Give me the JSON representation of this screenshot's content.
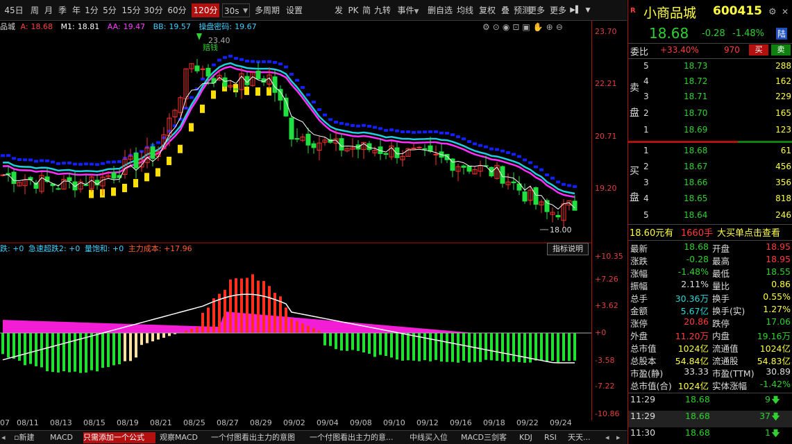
{
  "toolbar": {
    "periods": [
      "45日",
      "周",
      "月",
      "季",
      "年",
      "1分",
      "5分",
      "15分",
      "30分",
      "60分",
      "120分"
    ],
    "active_period": "120分",
    "period_dropdown": "30s",
    "items": [
      "多周期",
      "设置",
      "发",
      "PK",
      "简",
      "九转",
      "事件",
      "删自选",
      "均线",
      "复权",
      "叠",
      "预测",
      "更多"
    ],
    "more_arrow": "▶▌",
    "dropdown_icon": "▼"
  },
  "main_chart": {
    "stock_short": "品城",
    "indicators": [
      {
        "label": "A:",
        "value": "18.68",
        "color": "#ff4040"
      },
      {
        "label": "M1:",
        "value": "18.81",
        "color": "#ffffff"
      },
      {
        "label": "AA:",
        "value": "19.47",
        "color": "#ff40ff"
      },
      {
        "label": "BB:",
        "value": "19.57",
        "color": "#40d0ff"
      },
      {
        "label": "操盘密码:",
        "value": "19.67",
        "color": "#40d0ff"
      }
    ],
    "high_label": "23.40",
    "high_note": "赔钱",
    "low_label": "18.00",
    "price_ticks": [
      "23.70",
      "22.21",
      "20.71",
      "19.20"
    ]
  },
  "sub_chart": {
    "labels": [
      {
        "text": "跌: +0",
        "color": "#40d0ff"
      },
      {
        "text": "急速超跌2: +0",
        "color": "#40d0ff"
      },
      {
        "text": "量饱和: +0",
        "color": "#40d0ff"
      },
      {
        "text": "主力成本: +17.96",
        "color": "#ff6030"
      }
    ],
    "explain_button": "指标说明",
    "ticks": [
      "+10.35",
      "+7.26",
      "+3.62",
      "+0",
      "-3.58",
      "-7.22",
      "-10.86"
    ]
  },
  "dates": [
    "07",
    "08/11",
    "08/13",
    "08/15",
    "08/19",
    "08/21",
    "08/25",
    "08/27",
    "08/29",
    "09/02",
    "09/04",
    "09/08",
    "09/10",
    "09/12",
    "09/16",
    "09/18",
    "09/22",
    "09/24"
  ],
  "bottom_tabs": [
    "新建",
    "MACD",
    "只需添加一个公式",
    "观察MACD",
    "一个付图看出主力的意图",
    "一个付图看出主力的意...",
    "中线买入位",
    "MACD三剑客",
    "KDJ",
    "RSI",
    "天天..."
  ],
  "bottom_active": "只需添加一个公式",
  "panel": {
    "badge": "R",
    "name": "小商品城",
    "code": "600415",
    "price": "18.68",
    "change": "-0.28",
    "change_pct": "-1.48%",
    "tag": "陆",
    "weibi_label": "委比",
    "weibi_value": "+33.40%",
    "weibi_vol": "970",
    "buy_btn": "买",
    "sell_btn": "卖",
    "sell_label": [
      "卖",
      "盘"
    ],
    "buy_label": [
      "买",
      "盘"
    ],
    "asks": [
      {
        "lvl": "5",
        "price": "18.73",
        "vol": "288"
      },
      {
        "lvl": "4",
        "price": "18.72",
        "vol": "162"
      },
      {
        "lvl": "3",
        "price": "18.71",
        "vol": "229"
      },
      {
        "lvl": "2",
        "price": "18.70",
        "vol": "165"
      },
      {
        "lvl": "1",
        "price": "18.69",
        "vol": "123"
      }
    ],
    "bids": [
      {
        "lvl": "1",
        "price": "18.68",
        "vol": "61"
      },
      {
        "lvl": "2",
        "price": "18.67",
        "vol": "456"
      },
      {
        "lvl": "3",
        "price": "18.66",
        "vol": "356"
      },
      {
        "lvl": "4",
        "price": "18.65",
        "vol": "818"
      },
      {
        "lvl": "5",
        "price": "18.64",
        "vol": "246"
      }
    ],
    "big_order": {
      "price": "18.60元有",
      "qty": "1660手",
      "text": "大买单点击查看"
    },
    "quotes": [
      {
        "l1": "最新",
        "v1": "18.68",
        "c1": "green",
        "l2": "开盘",
        "v2": "18.95",
        "c2": "red"
      },
      {
        "l1": "涨跌",
        "v1": "-0.28",
        "c1": "green",
        "l2": "最高",
        "v2": "18.95",
        "c2": "red"
      },
      {
        "l1": "涨幅",
        "v1": "-1.48%",
        "c1": "green",
        "l2": "最低",
        "v2": "18.55",
        "c2": "green"
      },
      {
        "l1": "振幅",
        "v1": "2.11%",
        "c1": "white",
        "l2": "量比",
        "v2": "0.86",
        "c2": "yellow"
      },
      {
        "l1": "总手",
        "v1": "30.36万",
        "c1": "cyan",
        "l2": "换手",
        "v2": "0.55%",
        "c2": "yellow"
      },
      {
        "l1": "金额",
        "v1": "5.67亿",
        "c1": "cyan",
        "l2": "换手(实)",
        "v2": "1.27%",
        "c2": "yellow"
      },
      {
        "l1": "涨停",
        "v1": "20.86",
        "c1": "red",
        "l2": "跌停",
        "v2": "17.06",
        "c2": "green"
      },
      {
        "l1": "外盘",
        "v1": "11.20万",
        "c1": "red",
        "l2": "内盘",
        "v2": "19.16万",
        "c2": "green"
      },
      {
        "l1": "总市值",
        "v1": "1024亿",
        "c1": "yellow",
        "l2": "流通值",
        "v2": "1024亿",
        "c2": "yellow"
      },
      {
        "l1": "总股本",
        "v1": "54.84亿",
        "c1": "yellow",
        "l2": "流通股",
        "v2": "54.83亿",
        "c2": "yellow"
      },
      {
        "l1": "市盈(静)",
        "v1": "33.33",
        "c1": "white",
        "l2": "市盈(TTM)",
        "v2": "30.89",
        "c2": "white"
      },
      {
        "l1": "总市值(合)",
        "v1": "1024亿",
        "c1": "yellow",
        "l2": "实体涨幅",
        "v2": "-1.42%",
        "c2": "green"
      }
    ],
    "ticks": [
      {
        "time": "11:29",
        "price": "18.68",
        "vol": "9",
        "arrow": "🡇"
      },
      {
        "time": "11:29",
        "price": "18.68",
        "vol": "37",
        "arrow": "🡇"
      },
      {
        "time": "11:30",
        "price": "18.68",
        "vol": "1",
        "arrow": "🡇"
      }
    ]
  }
}
